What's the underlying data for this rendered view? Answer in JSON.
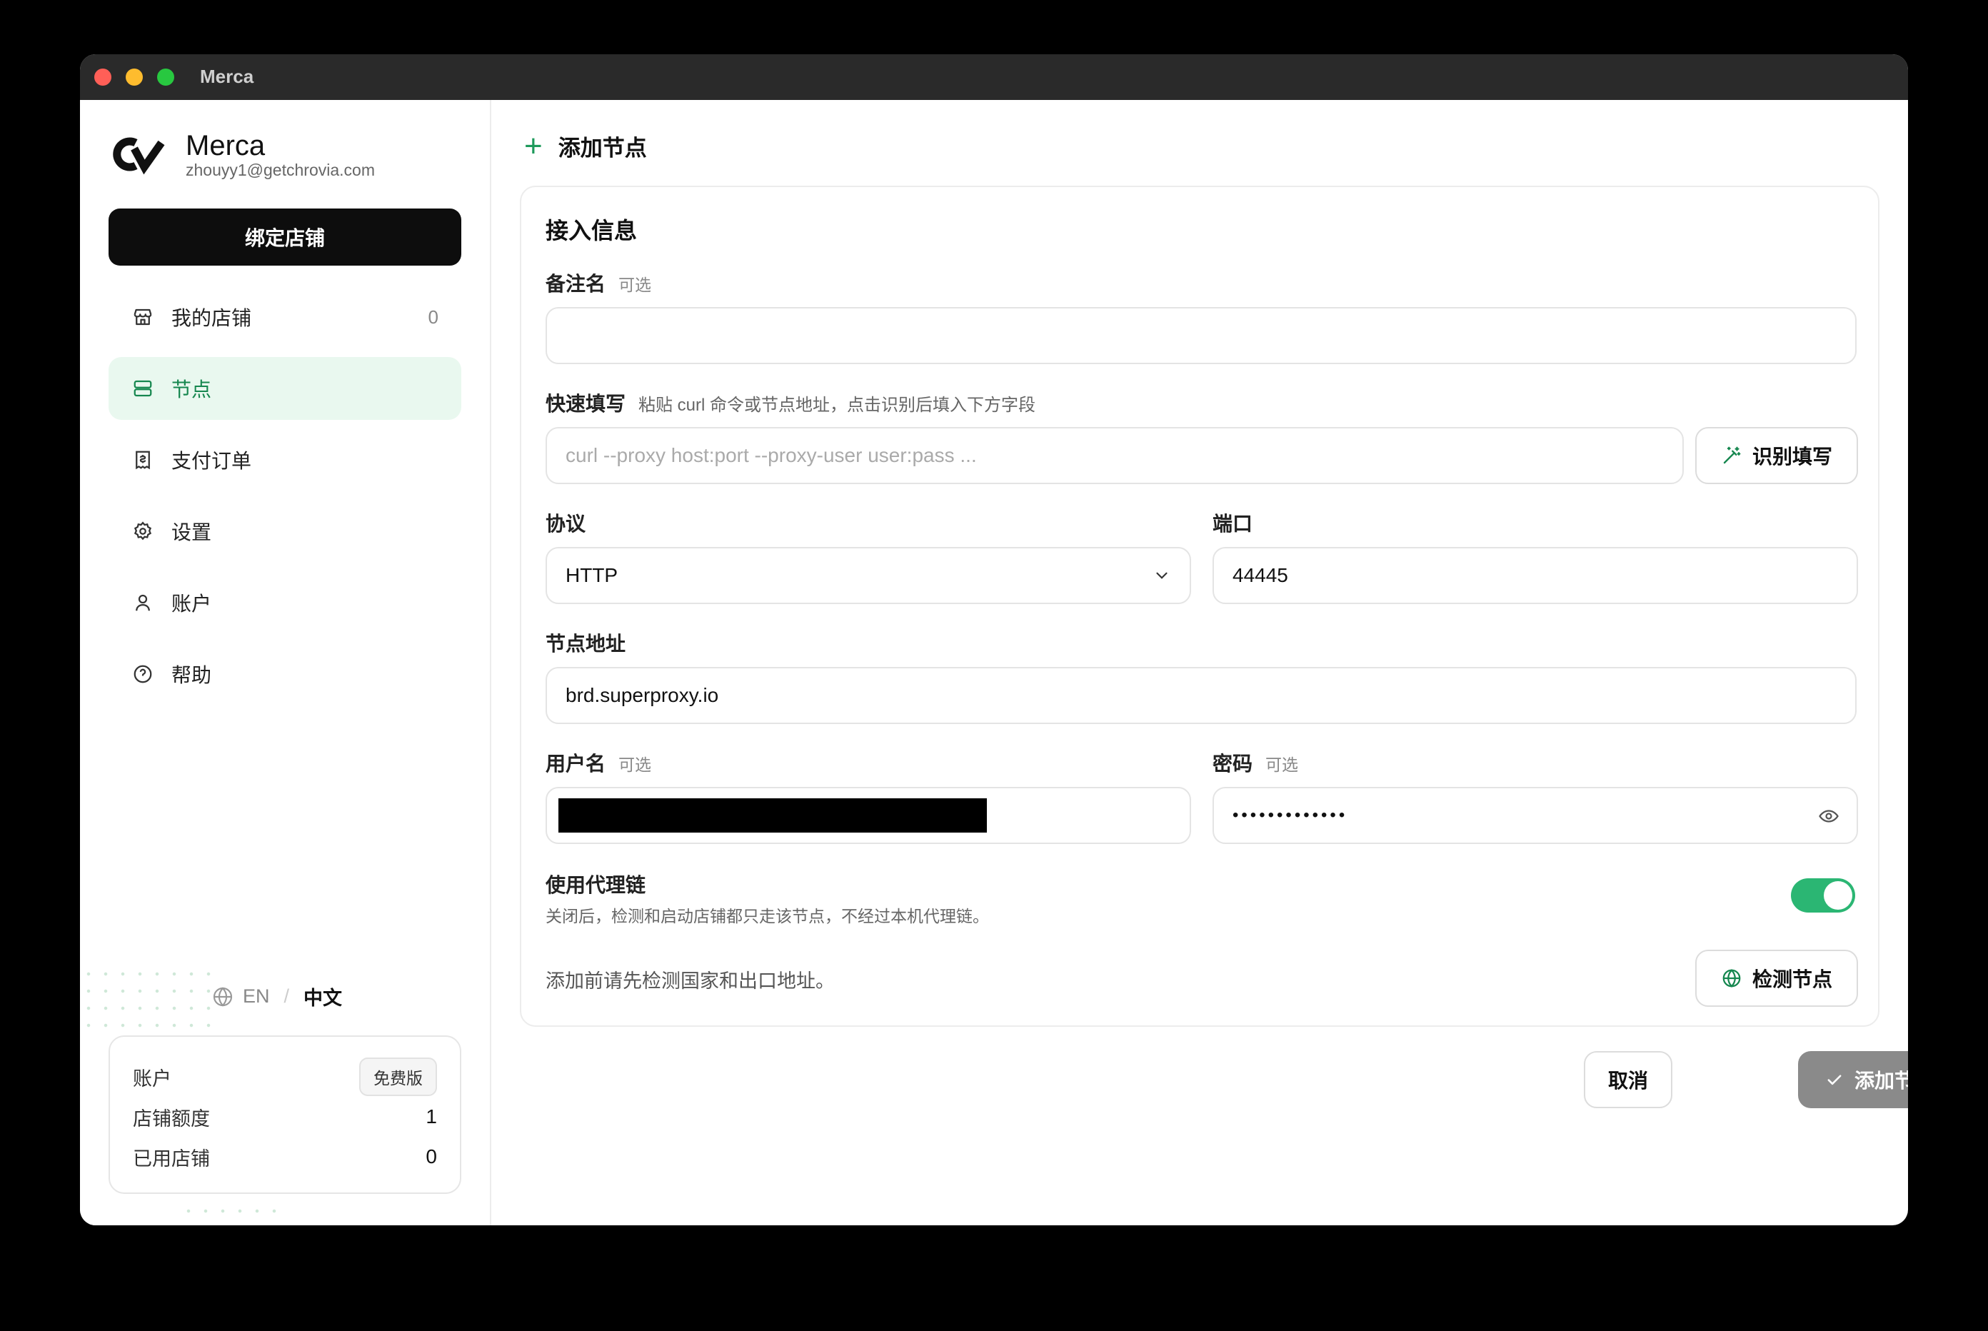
{
  "window": {
    "title": "Merca"
  },
  "brand": {
    "name": "Merca",
    "email": "zhouyy1@getchrovia.com"
  },
  "sidebar": {
    "bind_button": "绑定店铺",
    "items": [
      {
        "label": "我的店铺",
        "icon": "store-icon",
        "count": "0"
      },
      {
        "label": "节点",
        "icon": "server-icon",
        "active": true
      },
      {
        "label": "支付订单",
        "icon": "receipt-icon"
      },
      {
        "label": "设置",
        "icon": "gear-icon"
      },
      {
        "label": "账户",
        "icon": "user-icon"
      },
      {
        "label": "帮助",
        "icon": "help-icon"
      }
    ],
    "lang": {
      "en": "EN",
      "separator": "/",
      "zh": "中文"
    },
    "account_card": {
      "account_label": "账户",
      "plan_badge": "免费版",
      "quota_label": "店铺额度",
      "quota_value": "1",
      "used_label": "已用店铺",
      "used_value": "0"
    }
  },
  "main": {
    "header": "添加节点",
    "card": {
      "title": "接入信息",
      "remark": {
        "label": "备注名",
        "optional": "可选",
        "value": ""
      },
      "quick_fill": {
        "label": "快速填写",
        "hint": "粘贴 curl 命令或节点地址，点击识别后填入下方字段",
        "placeholder": "curl --proxy host:port --proxy-user user:pass ...",
        "button": "识别填写"
      },
      "protocol": {
        "label": "协议",
        "value": "HTTP"
      },
      "port": {
        "label": "端口",
        "value": "44445"
      },
      "address": {
        "label": "节点地址",
        "value": "brd.superproxy.io"
      },
      "username": {
        "label": "用户名",
        "optional": "可选"
      },
      "password": {
        "label": "密码",
        "optional": "可选",
        "masked": "•••••••••••••"
      },
      "proxy_chain": {
        "label": "使用代理链",
        "desc": "关闭后，检测和启动店铺都只走该节点，不经过本机代理链。",
        "enabled": true
      },
      "check_note": "添加前请先检测国家和出口地址。",
      "check_button": "检测节点"
    },
    "actions": {
      "cancel": "取消",
      "submit": "添加节点"
    }
  },
  "colors": {
    "accent": "#1e9a5b",
    "toggle_on": "#2bb673",
    "active_bg": "#e9f8ef",
    "submit_disabled": "#8a8a8a"
  }
}
